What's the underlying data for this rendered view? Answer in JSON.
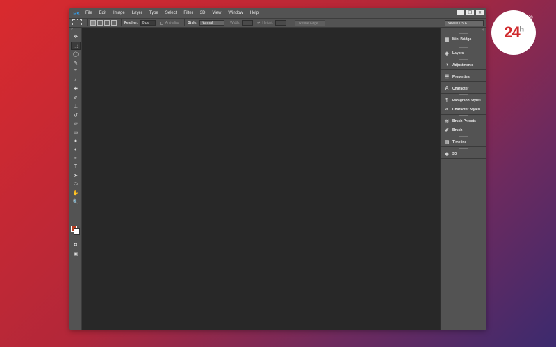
{
  "app": {
    "logo": "Ps",
    "menu": [
      "File",
      "Edit",
      "Image",
      "Layer",
      "Type",
      "Select",
      "Filter",
      "3D",
      "View",
      "Window",
      "Help"
    ]
  },
  "options_bar": {
    "feather_label": "Feather:",
    "feather_value": "0 px",
    "antialias_label": "Anti-alias",
    "style_label": "Style:",
    "style_value": "Normal",
    "width_label": "Width:",
    "height_label": "Height:",
    "refine_edge": "Refine Edge...",
    "workspace": "New in CS 6"
  },
  "tools": [
    {
      "name": "move-tool",
      "glyph": "✥"
    },
    {
      "name": "rectangular-marquee-tool",
      "glyph": "⬚",
      "active": true
    },
    {
      "name": "lasso-tool",
      "glyph": "◯"
    },
    {
      "name": "quick-selection-tool",
      "glyph": "✎"
    },
    {
      "name": "crop-tool",
      "glyph": "⌗"
    },
    {
      "name": "eyedropper-tool",
      "glyph": "⁄"
    },
    {
      "name": "spot-healing-brush-tool",
      "glyph": "✚"
    },
    {
      "name": "brush-tool",
      "glyph": "✐"
    },
    {
      "name": "clone-stamp-tool",
      "glyph": "⊥"
    },
    {
      "name": "history-brush-tool",
      "glyph": "↺"
    },
    {
      "name": "eraser-tool",
      "glyph": "▱"
    },
    {
      "name": "gradient-tool",
      "glyph": "▭"
    },
    {
      "name": "blur-tool",
      "glyph": "●"
    },
    {
      "name": "dodge-tool",
      "glyph": "◐"
    },
    {
      "name": "pen-tool",
      "glyph": "✒"
    },
    {
      "name": "type-tool",
      "glyph": "T"
    },
    {
      "name": "path-selection-tool",
      "glyph": "➤"
    },
    {
      "name": "ellipse-tool",
      "glyph": "⬭"
    },
    {
      "name": "hand-tool",
      "glyph": "✋"
    },
    {
      "name": "zoom-tool",
      "glyph": "🔍"
    }
  ],
  "panels": [
    {
      "items": [
        {
          "icon": "mini-bridge-icon",
          "glyph": "▦",
          "label": "Mini Bridge"
        }
      ]
    },
    {
      "items": [
        {
          "icon": "layers-icon",
          "glyph": "◈",
          "label": "Layers"
        }
      ]
    },
    {
      "items": [
        {
          "icon": "adjustments-icon",
          "glyph": "◑",
          "label": "Adjustments"
        }
      ]
    },
    {
      "items": [
        {
          "icon": "properties-icon",
          "glyph": "☰",
          "label": "Properties"
        }
      ]
    },
    {
      "items": [
        {
          "icon": "character-icon",
          "glyph": "A",
          "label": "Character"
        }
      ]
    },
    {
      "items": [
        {
          "icon": "paragraph-styles-icon",
          "glyph": "¶",
          "label": "Paragraph Styles"
        },
        {
          "icon": "character-styles-icon",
          "glyph": "a",
          "label": "Character Styles"
        }
      ]
    },
    {
      "items": [
        {
          "icon": "brush-presets-icon",
          "glyph": "≋",
          "label": "Brush Presets"
        },
        {
          "icon": "brush-icon",
          "glyph": "✐",
          "label": "Brush"
        }
      ]
    },
    {
      "items": [
        {
          "icon": "timeline-icon",
          "glyph": "▤",
          "label": "Timeline"
        }
      ]
    },
    {
      "items": [
        {
          "icon": "3d-icon",
          "glyph": "◆",
          "label": "3D"
        }
      ]
    }
  ],
  "colors": {
    "foreground": "#b83c1e",
    "background": "#ffffff",
    "canvas": "#282828",
    "chrome": "#535353"
  },
  "watermark": {
    "text": "24",
    "sup": "h",
    "reg": "®"
  }
}
